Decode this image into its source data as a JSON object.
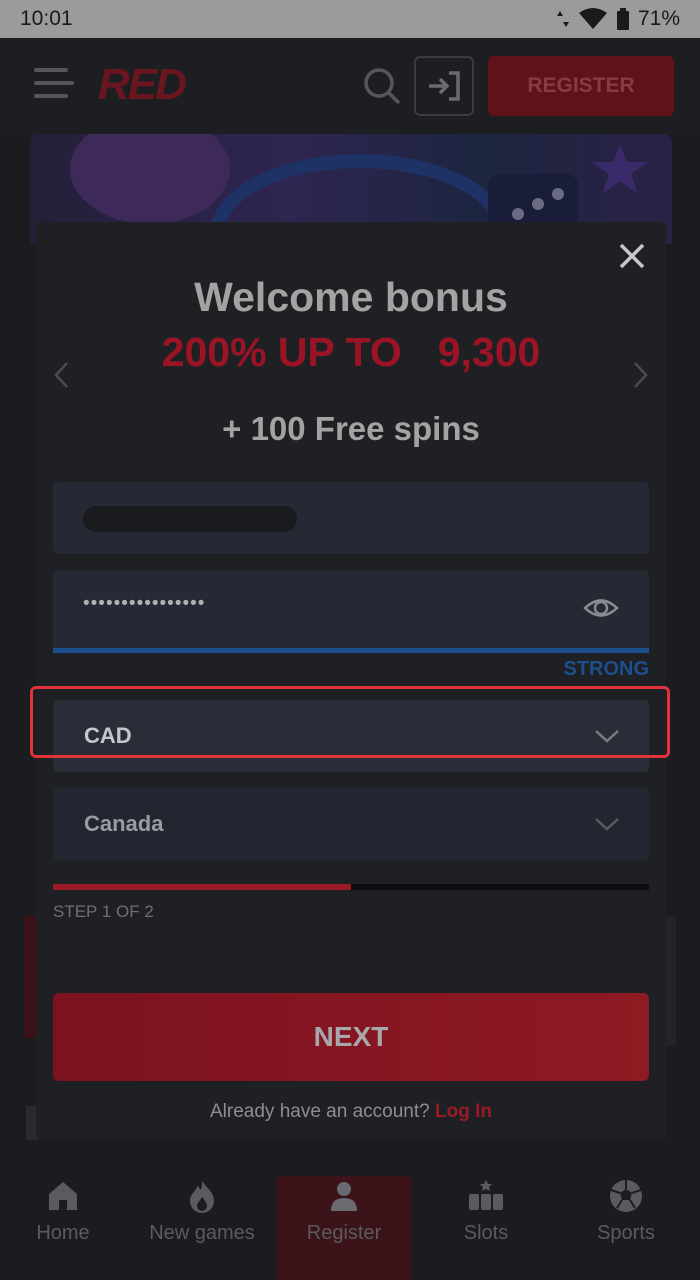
{
  "status_bar": {
    "time": "10:01",
    "battery": "71%"
  },
  "header": {
    "logo": "RED",
    "register_label": "REGISTER"
  },
  "modal": {
    "title": "Welcome bonus",
    "promo_part1": "200% UP TO",
    "promo_part2": "9,300",
    "spins": "+ 100 Free spins",
    "password_masked": "••••••••••••••••",
    "password_strength": "STRONG",
    "currency": "CAD",
    "country": "Canada",
    "step_text": "STEP 1 OF 2",
    "step_progress": 0.5,
    "next_label": "NEXT",
    "account_prompt": "Already have an account?",
    "login_label": "Log In"
  },
  "bottom_nav": {
    "tabs": [
      {
        "label": "Home",
        "icon": "home-icon"
      },
      {
        "label": "New games",
        "icon": "flame-icon"
      },
      {
        "label": "Register",
        "icon": "user-icon"
      },
      {
        "label": "Slots",
        "icon": "slots-icon"
      },
      {
        "label": "Sports",
        "icon": "soccer-ball-icon"
      }
    ]
  },
  "colors": {
    "accent": "#e2323a",
    "strength": "#1d4f8f",
    "brand_red": "#9a1426"
  }
}
